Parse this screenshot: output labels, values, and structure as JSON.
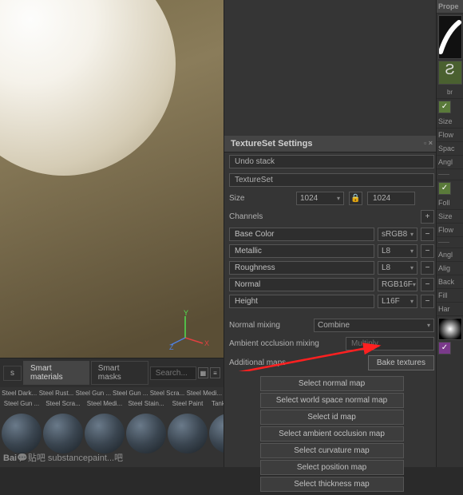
{
  "viewport": {
    "axis": {
      "x": "X",
      "y": "Y",
      "z": "Z"
    }
  },
  "far_right": {
    "header": "Prope",
    "labels": [
      "Size",
      "Flow",
      "Spac",
      "Angl",
      "",
      "Foll",
      "Size",
      "Flow",
      "",
      "Angl",
      "Alig",
      "Back",
      "Fill",
      "Har"
    ],
    "brush_suffix": "br"
  },
  "textureset": {
    "title": "TextureSet Settings",
    "undo": "Undo stack",
    "name": "TextureSet",
    "size_label": "Size",
    "size_value": "1024",
    "size_locked": "1024",
    "channels_label": "Channels",
    "channels": [
      {
        "name": "Base Color",
        "fmt": "sRGB8"
      },
      {
        "name": "Metallic",
        "fmt": "L8"
      },
      {
        "name": "Roughness",
        "fmt": "L8"
      },
      {
        "name": "Normal",
        "fmt": "RGB16F"
      },
      {
        "name": "Height",
        "fmt": "L16F"
      }
    ],
    "normal_mixing_label": "Normal mixing",
    "normal_mixing_value": "Combine",
    "ao_mixing_label": "Ambient occlusion mixing",
    "ao_mixing_value": "Multiply",
    "additional_maps_label": "Additional maps",
    "bake_button": "Bake textures",
    "map_buttons": [
      "Select normal map",
      "Select world space normal map",
      "Select id map",
      "Select ambient occlusion map",
      "Select curvature map",
      "Select position map",
      "Select thickness map"
    ]
  },
  "shelf": {
    "tabs": [
      "s",
      "Smart materials",
      "Smart masks"
    ],
    "search_placeholder": "Search...",
    "items": [
      "Steel Dark...",
      "Steel Rust...",
      "Steel Gun ...",
      "Steel Gun ...",
      "Steel Scra...",
      "Steel Medi...",
      "Steel Stain...",
      "Steel Paint",
      "Tank Paint..."
    ]
  },
  "watermark": {
    "brand": "Bai",
    "text1": "贴吧",
    "text2": "substancepaint...吧"
  }
}
